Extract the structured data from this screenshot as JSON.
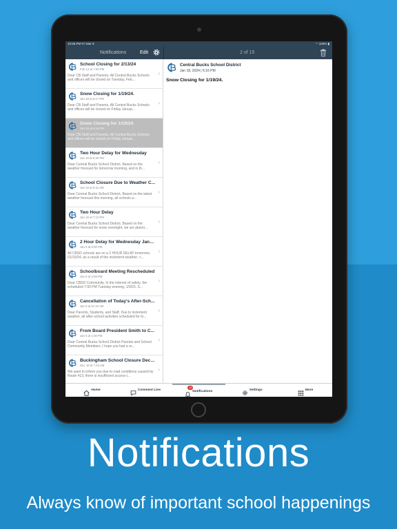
{
  "status_bar": {
    "time_date": "10:58 PM  Fri Mar 8",
    "battery": "100%"
  },
  "nav": {
    "title": "Notifications",
    "edit_label": "Edit",
    "counter": "2 of 15"
  },
  "notifications": [
    {
      "title": "School Closing for 2/13/24",
      "date": "Feb 13 at 7:00 PM",
      "preview": "Dear CB Staff and Parents,  All Central Bucks Schools and offices will be closed on Tuesday, Feb...",
      "selected": false
    },
    {
      "title": "Snow Closing for 1/19/24.",
      "date": "Jan 18 at 6:17 PM",
      "preview": "Dear CB Staff and Parents,  All Central Bucks Schools and offices will be closed on Friday Januar...",
      "selected": false
    },
    {
      "title": "Snow Closing for 1/19/24.",
      "date": "Jan 18 at 6:16 PM",
      "preview": "Dear CB Staff and Parents,  All Central Bucks Schools and offices will be closed on Friday Januar...",
      "selected": true
    },
    {
      "title": "Two Hour Delay for Wednesday",
      "date": "Jan 16 at 6:30 PM",
      "preview": "Dear Central Bucks School District,  Based on the weather forecast for tomorrow morning, and in th...",
      "selected": false
    },
    {
      "title": "School Closure Due to Weather C...",
      "date": "Jan 16 at 9:41 AM",
      "preview": "Dear Central Bucks School District,    Based on the latest weather forecast this morning, all schools a...",
      "selected": false
    },
    {
      "title": "Two Hour Delay",
      "date": "Jan 15 at 7:12 PM",
      "preview": "Dear Central Bucks School District,  Based on the weather forecast for snow overnight, we are planni...",
      "selected": false
    },
    {
      "title": "2 Hour Delay for Wednesday Janu...",
      "date": "Jan 9 at 6:00 PM",
      "preview": "All CBSD schools are on a 2 HOUR DELAY tomorrow, 01/10/24, as a result of the inclement weather.  <...",
      "selected": false
    },
    {
      "title": "Schoolboard Meeting Rescheduled",
      "date": "Jan 9 at 2:59 PM",
      "preview": "Dear CBSD Community,  In the interest of safety, the scheduled 7:00 PM Tuesday evening, 1/9/23, S...",
      "selected": false
    },
    {
      "title": "Cancellation of Today's After-Sch...",
      "date": "Jan 9 at 11:10 AM",
      "preview": "Dear Parents, Students, and Staff,  Due to inclement weather, all after-school activities scheduled for to...",
      "selected": false
    },
    {
      "title": "From Board President Smith to C...",
      "date": "Jan 8 at 1:00 PM",
      "preview": "Dear Central Bucks School District Parents and School Community Members,  I hope you had a re...",
      "selected": false
    },
    {
      "title": "Buckingham School Closure Dece...",
      "date": "Dec 18 at 7:43 AM",
      "preview": "We want to inform you due to road conditions caused by Route 413, there is insufficient access t...",
      "selected": false
    }
  ],
  "detail": {
    "sender": "Central Bucks School District",
    "date": "Jan 18, 2024 | 6:16 PM",
    "subject": "Snow Closing for 1/19/24."
  },
  "tabs": [
    {
      "label": "Home",
      "icon": "home-icon"
    },
    {
      "label": "Comment Line",
      "icon": "chat-icon"
    },
    {
      "label": "Notifications",
      "icon": "bell-icon",
      "badge": "15",
      "active": true
    },
    {
      "label": "Settings",
      "icon": "gear-icon"
    },
    {
      "label": "More",
      "icon": "grid-icon"
    }
  ],
  "caption": {
    "headline": "Notifications",
    "subline": "Always know of important school happenings"
  },
  "colors": {
    "background": "#2a9ad6",
    "navbar": "#2f4455",
    "selected_row": "#bdbdbd",
    "badge": "#d9332b"
  }
}
